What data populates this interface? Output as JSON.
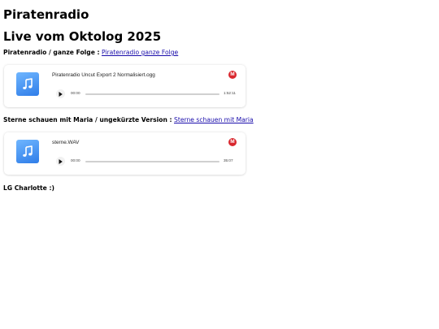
{
  "page": {
    "title": "Piratenradio",
    "subtitle": "Live vom Oktolog 2025",
    "footer": "LG Charlotte :)"
  },
  "sections": [
    {
      "label": "Piratenradio / ganze Folge :",
      "link_text": "Piratenradio ganze Folge",
      "player": {
        "file_name": "Piratenradio Uncut Export 2 Normalisiert.ogg",
        "current_time": "00:00",
        "duration": "1:52:11",
        "progress": 0,
        "badge_letter": "M",
        "badge_icon": "mega-logo-icon",
        "thumb_icon": "music-note-icon",
        "play_icon": "play-icon"
      }
    },
    {
      "label": "Sterne schauen mit Maria / ungekürzte Version :",
      "link_text": "Sterne schauen mit Maria",
      "player": {
        "file_name": "sterne.WAV",
        "current_time": "00:00",
        "duration": "35:07",
        "progress": 0,
        "badge_letter": "M",
        "badge_icon": "mega-logo-icon",
        "thumb_icon": "music-note-icon",
        "play_icon": "play-icon"
      }
    }
  ],
  "colors": {
    "link": "#1a0dab",
    "mega_red": "#d9272e",
    "thumb_blue": "#2f7de8"
  }
}
